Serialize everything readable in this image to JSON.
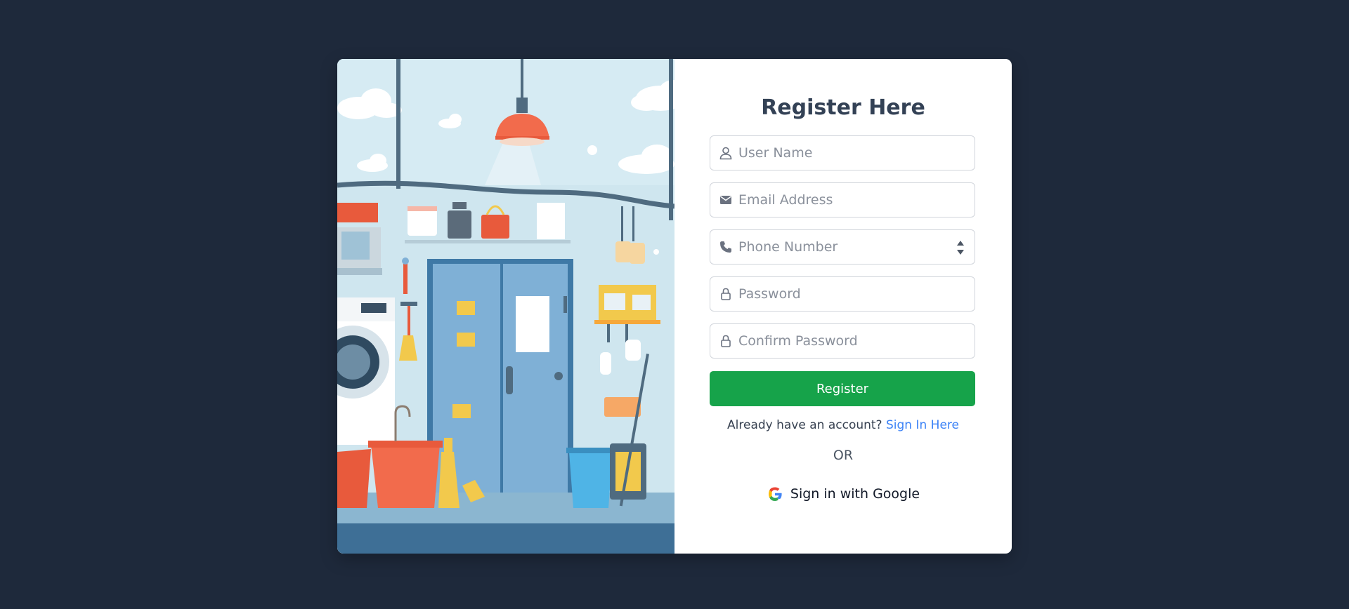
{
  "form": {
    "title": "Register Here",
    "fields": [
      {
        "icon": "user-icon",
        "placeholder": "User Name",
        "value": ""
      },
      {
        "icon": "envelope-icon",
        "placeholder": "Email Address",
        "value": ""
      },
      {
        "icon": "phone-icon",
        "placeholder": "Phone Number",
        "value": ""
      },
      {
        "icon": "lock-icon",
        "placeholder": "Password",
        "value": ""
      },
      {
        "icon": "lock-icon",
        "placeholder": "Confirm Password",
        "value": ""
      }
    ],
    "register_label": "Register",
    "signin_prompt": "Already have an account?",
    "signin_link": "Sign In Here",
    "or_label": "OR",
    "google_label": "Sign in with Google"
  },
  "illustration": {
    "icon": "laundry-room-illustration"
  },
  "colors": {
    "page_background": "#1e293b",
    "card_background": "#ffffff",
    "register_button": "#16a34a",
    "link": "#3b82f6",
    "title": "#334155"
  }
}
